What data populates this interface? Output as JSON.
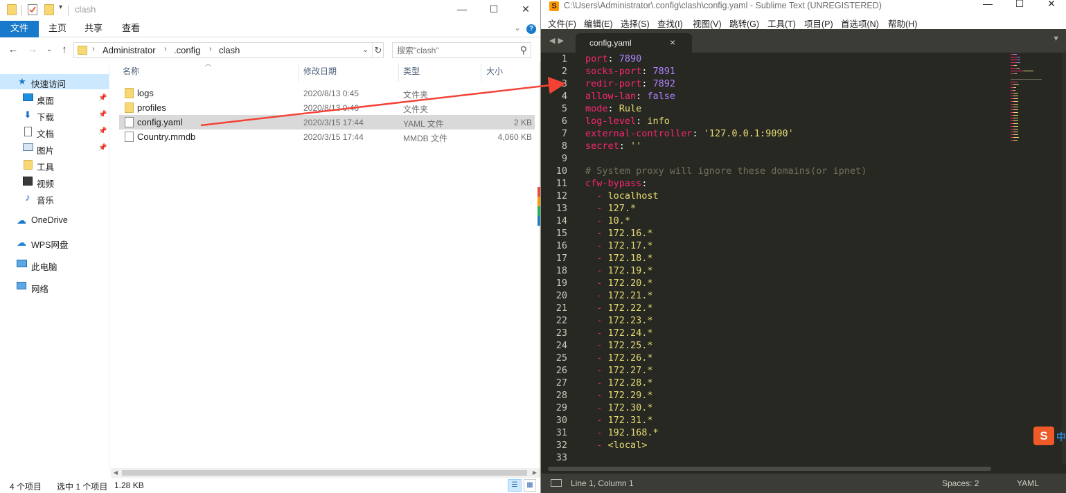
{
  "explorer": {
    "window_title": "clash",
    "ribbon": {
      "tabs": [
        "文件",
        "主页",
        "共享",
        "查看"
      ]
    },
    "address": {
      "crumbs": [
        "Administrator",
        ".config",
        "clash"
      ],
      "search_placeholder": "搜索\"clash\""
    },
    "nav_pane": {
      "quick_access": "快速访问",
      "items": [
        "桌面",
        "下载",
        "文档",
        "图片",
        "工具",
        "视频",
        "音乐"
      ],
      "roots": [
        "OneDrive",
        "WPS网盘",
        "此电脑",
        "网络"
      ]
    },
    "columns": [
      "名称",
      "修改日期",
      "类型",
      "大小"
    ],
    "files": [
      {
        "name": "logs",
        "date": "2020/8/13 0:45",
        "type": "文件夹",
        "size": "",
        "icon": "folder-icon"
      },
      {
        "name": "profiles",
        "date": "2020/8/13 0:46",
        "type": "文件夹",
        "size": "",
        "icon": "folder-icon"
      },
      {
        "name": "config.yaml",
        "date": "2020/3/15 17:44",
        "type": "YAML 文件",
        "size": "2 KB",
        "icon": "document-icon"
      },
      {
        "name": "Country.mmdb",
        "date": "2020/3/15 17:44",
        "type": "MMDB 文件",
        "size": "4,060 KB",
        "icon": "document-icon"
      }
    ],
    "selected_index": 2,
    "status": {
      "count": "4 个项目",
      "selection": "选中 1 个项目",
      "size": "1.28 KB"
    }
  },
  "sublime": {
    "window_title": "C:\\Users\\Administrator\\.config\\clash\\config.yaml - Sublime Text (UNREGISTERED)",
    "menu": [
      "文件(F)",
      "编辑(E)",
      "选择(S)",
      "查找(I)",
      "视图(V)",
      "跳转(G)",
      "工具(T)",
      "项目(P)",
      "首选项(N)",
      "帮助(H)"
    ],
    "tab_label": "config.yaml",
    "code_lines": [
      [
        [
          "port",
          "key"
        ],
        [
          ": ",
          "punc"
        ],
        [
          "7890",
          "num"
        ]
      ],
      [
        [
          "socks-port",
          "key"
        ],
        [
          ": ",
          "punc"
        ],
        [
          "7891",
          "num"
        ]
      ],
      [
        [
          "redir-port",
          "key"
        ],
        [
          ": ",
          "punc"
        ],
        [
          "7892",
          "num"
        ]
      ],
      [
        [
          "allow-lan",
          "key"
        ],
        [
          ": ",
          "punc"
        ],
        [
          "false",
          "num"
        ]
      ],
      [
        [
          "mode",
          "key"
        ],
        [
          ": ",
          "punc"
        ],
        [
          "Rule",
          "str"
        ]
      ],
      [
        [
          "log-level",
          "key"
        ],
        [
          ": ",
          "punc"
        ],
        [
          "info",
          "str"
        ]
      ],
      [
        [
          "external-controller",
          "key"
        ],
        [
          ": ",
          "punc"
        ],
        [
          "'127.0.0.1:9090'",
          "str"
        ]
      ],
      [
        [
          "secret",
          "key"
        ],
        [
          ": ",
          "punc"
        ],
        [
          "''",
          "str"
        ]
      ],
      [],
      [
        [
          "# System proxy will ignore these domains(or ipnet)",
          "cmt"
        ]
      ],
      [
        [
          "cfw-bypass",
          "key"
        ],
        [
          ":",
          "punc"
        ]
      ],
      [
        [
          "  - ",
          "key"
        ],
        [
          "localhost",
          "str"
        ]
      ],
      [
        [
          "  - ",
          "key"
        ],
        [
          "127.*",
          "str"
        ]
      ],
      [
        [
          "  - ",
          "key"
        ],
        [
          "10.*",
          "str"
        ]
      ],
      [
        [
          "  - ",
          "key"
        ],
        [
          "172.16.*",
          "str"
        ]
      ],
      [
        [
          "  - ",
          "key"
        ],
        [
          "172.17.*",
          "str"
        ]
      ],
      [
        [
          "  - ",
          "key"
        ],
        [
          "172.18.*",
          "str"
        ]
      ],
      [
        [
          "  - ",
          "key"
        ],
        [
          "172.19.*",
          "str"
        ]
      ],
      [
        [
          "  - ",
          "key"
        ],
        [
          "172.20.*",
          "str"
        ]
      ],
      [
        [
          "  - ",
          "key"
        ],
        [
          "172.21.*",
          "str"
        ]
      ],
      [
        [
          "  - ",
          "key"
        ],
        [
          "172.22.*",
          "str"
        ]
      ],
      [
        [
          "  - ",
          "key"
        ],
        [
          "172.23.*",
          "str"
        ]
      ],
      [
        [
          "  - ",
          "key"
        ],
        [
          "172.24.*",
          "str"
        ]
      ],
      [
        [
          "  - ",
          "key"
        ],
        [
          "172.25.*",
          "str"
        ]
      ],
      [
        [
          "  - ",
          "key"
        ],
        [
          "172.26.*",
          "str"
        ]
      ],
      [
        [
          "  - ",
          "key"
        ],
        [
          "172.27.*",
          "str"
        ]
      ],
      [
        [
          "  - ",
          "key"
        ],
        [
          "172.28.*",
          "str"
        ]
      ],
      [
        [
          "  - ",
          "key"
        ],
        [
          "172.29.*",
          "str"
        ]
      ],
      [
        [
          "  - ",
          "key"
        ],
        [
          "172.30.*",
          "str"
        ]
      ],
      [
        [
          "  - ",
          "key"
        ],
        [
          "172.31.*",
          "str"
        ]
      ],
      [
        [
          "  - ",
          "key"
        ],
        [
          "192.168.*",
          "str"
        ]
      ],
      [
        [
          "  - ",
          "key"
        ],
        [
          "<local>",
          "str"
        ]
      ],
      []
    ],
    "status": {
      "position": "Line 1, Column 1",
      "spaces": "Spaces: 2",
      "syntax": "YAML"
    }
  },
  "colors": {
    "accent": "#1979ca",
    "selection": "#d9d9d9",
    "annotation_arrow": "#f44336",
    "editor_bg": "#272822",
    "key": "#f92672",
    "number": "#ae81ff",
    "string": "#e6db74",
    "comment": "#75715e"
  }
}
